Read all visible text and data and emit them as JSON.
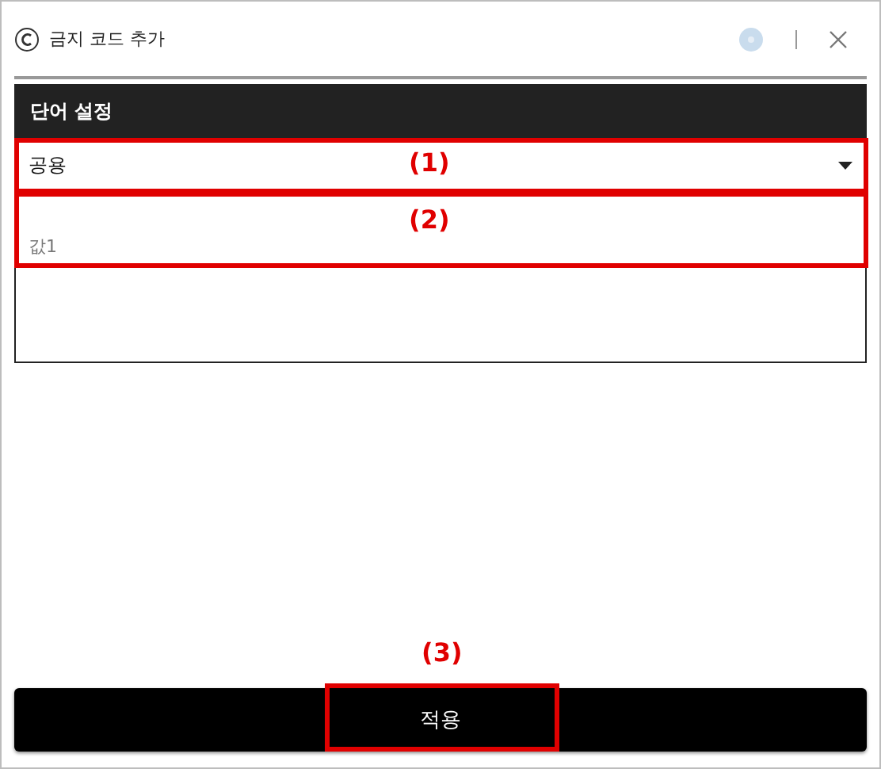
{
  "window": {
    "title": "금지 코드 추가"
  },
  "section": {
    "title": "단어 설정"
  },
  "select": {
    "value": "공용"
  },
  "value_field": {
    "placeholder": "값1"
  },
  "apply_button": {
    "label": "적용"
  },
  "annotations": [
    {
      "label": "(1)"
    },
    {
      "label": "(2)"
    },
    {
      "label": "(3)"
    }
  ]
}
